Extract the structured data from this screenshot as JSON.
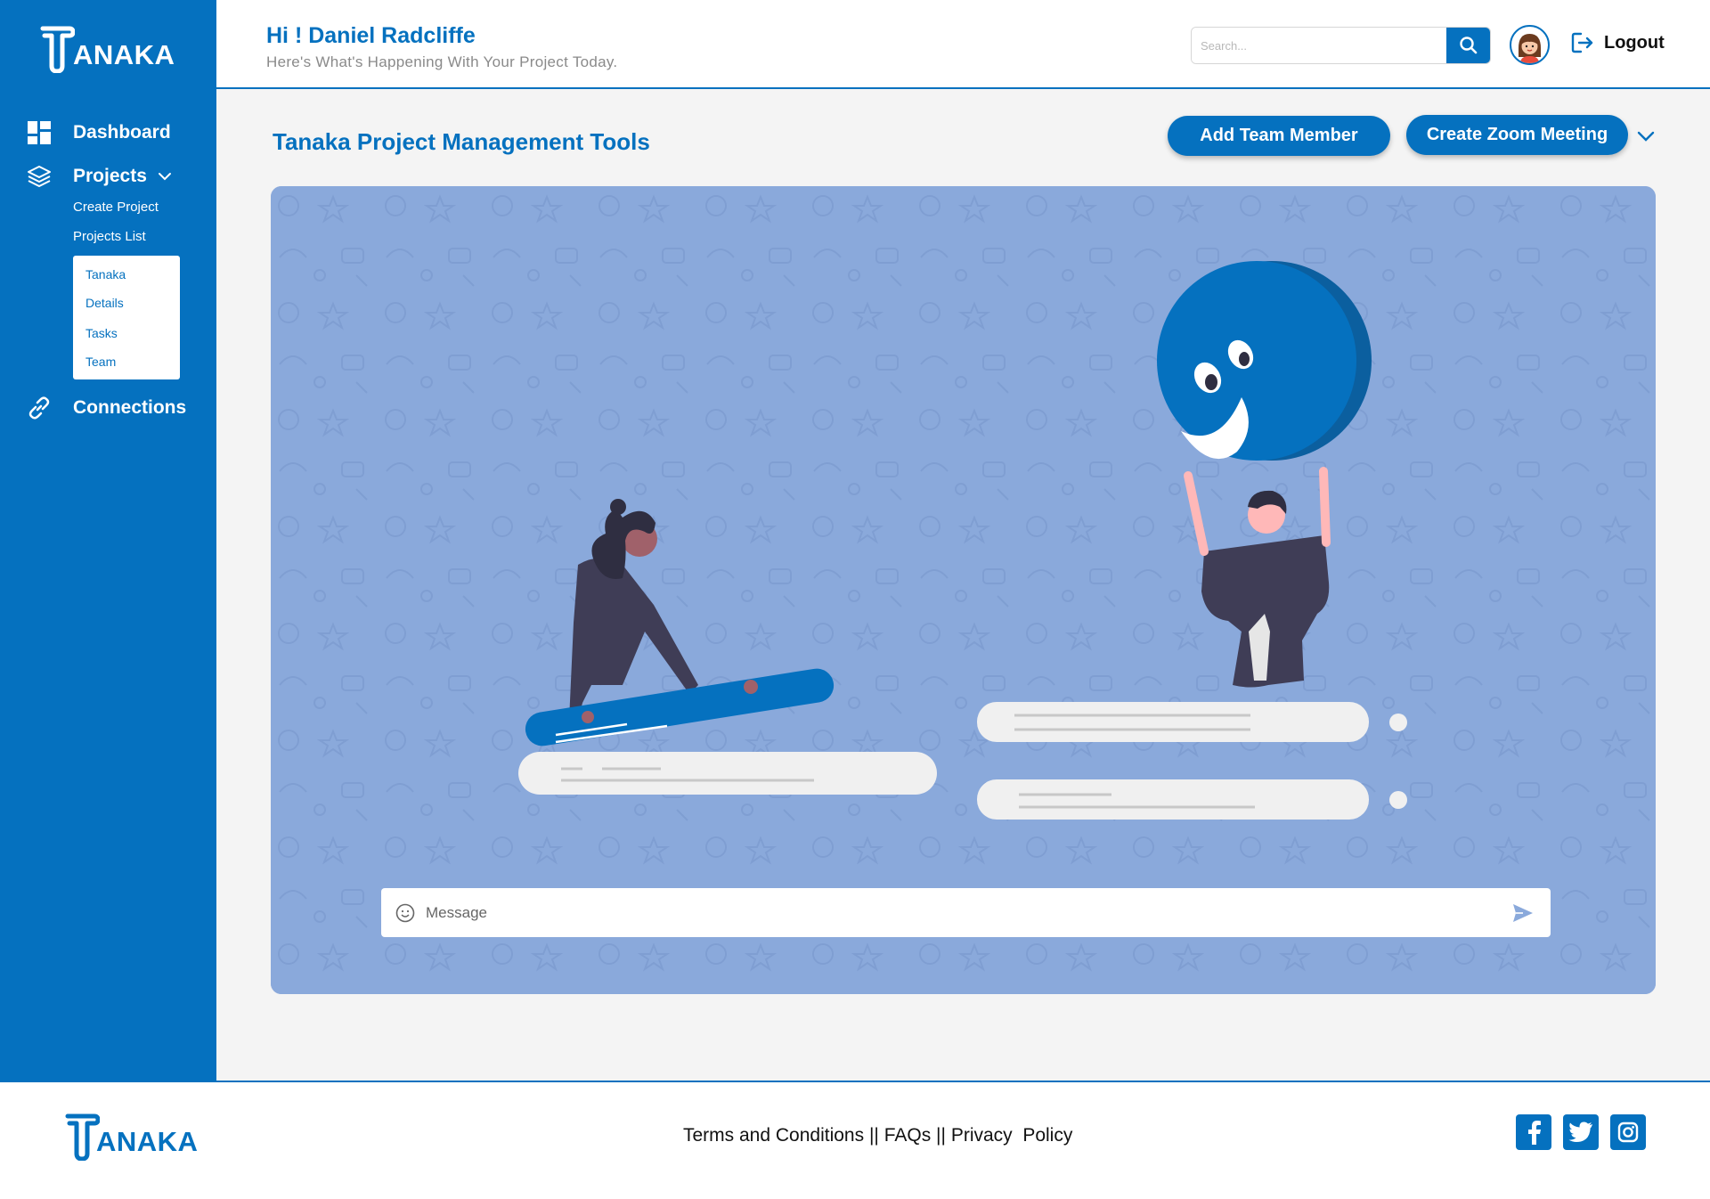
{
  "brand": {
    "name": "ANAKA",
    "logo_letter": "T"
  },
  "sidebar": {
    "items": [
      {
        "label": "Dashboard",
        "icon": "dashboard-icon"
      },
      {
        "label": "Projects",
        "icon": "layers-icon"
      },
      {
        "label": "Connections",
        "icon": "link-icon"
      }
    ],
    "projects_sub": {
      "create": "Create Project",
      "list": "Projects List"
    },
    "project_menu": [
      "Tanaka",
      "Details",
      "Tasks",
      "Team"
    ]
  },
  "header": {
    "greeting": "Hi ! Daniel Radcliffe",
    "subtitle": "Here's What's Happening With Your Project Today.",
    "search_placeholder": "Search...",
    "logout": "Logout"
  },
  "main": {
    "title": "Tanaka Project Management Tools",
    "add_member": "Add Team Member",
    "create_zoom": "Create Zoom Meeting",
    "message_placeholder": "Message"
  },
  "footer": {
    "links": [
      "Terms and Conditions",
      "FAQs",
      "Privacy  Policy"
    ],
    "separator": " || ",
    "social": [
      "facebook-icon",
      "twitter-icon",
      "instagram-icon"
    ]
  },
  "colors": {
    "primary": "#0571bf",
    "chat_bg": "#8aa9db",
    "text_muted": "#8a8a8a"
  }
}
